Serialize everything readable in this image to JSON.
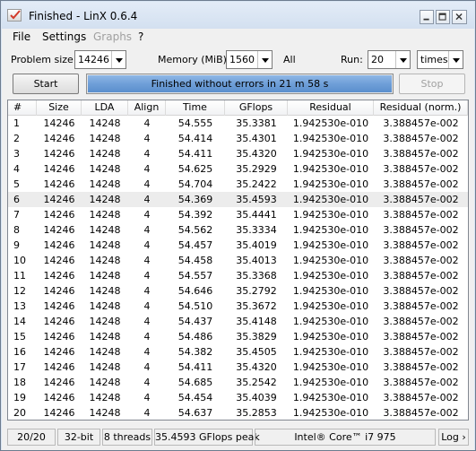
{
  "window": {
    "title": "Finished - LinX 0.6.4"
  },
  "menu": {
    "file": "File",
    "settings": "Settings",
    "graphs": "Graphs",
    "help": "?"
  },
  "controls": {
    "problem_size_label": "Problem size:",
    "problem_size_value": "14246",
    "memory_label": "Memory (MiB):",
    "memory_value": "1560",
    "all_label": "All",
    "run_label": "Run:",
    "run_value": "20",
    "times_value": "times",
    "start_label": "Start",
    "stop_label": "Stop"
  },
  "progress": {
    "text": "Finished without errors in 21 m 58 s",
    "fraction": 1.0,
    "color": "#6f9fd8"
  },
  "table": {
    "headers": [
      "#",
      "Size",
      "LDA",
      "Align",
      "Time",
      "GFlops",
      "Residual",
      "Residual (norm.)"
    ],
    "rows": [
      [
        "1",
        "14246",
        "14248",
        "4",
        "54.555",
        "35.3381",
        "1.942530e-010",
        "3.388457e-002"
      ],
      [
        "2",
        "14246",
        "14248",
        "4",
        "54.414",
        "35.4301",
        "1.942530e-010",
        "3.388457e-002"
      ],
      [
        "3",
        "14246",
        "14248",
        "4",
        "54.411",
        "35.4320",
        "1.942530e-010",
        "3.388457e-002"
      ],
      [
        "4",
        "14246",
        "14248",
        "4",
        "54.625",
        "35.2929",
        "1.942530e-010",
        "3.388457e-002"
      ],
      [
        "5",
        "14246",
        "14248",
        "4",
        "54.704",
        "35.2422",
        "1.942530e-010",
        "3.388457e-002"
      ],
      [
        "6",
        "14246",
        "14248",
        "4",
        "54.369",
        "35.4593",
        "1.942530e-010",
        "3.388457e-002"
      ],
      [
        "7",
        "14246",
        "14248",
        "4",
        "54.392",
        "35.4441",
        "1.942530e-010",
        "3.388457e-002"
      ],
      [
        "8",
        "14246",
        "14248",
        "4",
        "54.562",
        "35.3334",
        "1.942530e-010",
        "3.388457e-002"
      ],
      [
        "9",
        "14246",
        "14248",
        "4",
        "54.457",
        "35.4019",
        "1.942530e-010",
        "3.388457e-002"
      ],
      [
        "10",
        "14246",
        "14248",
        "4",
        "54.458",
        "35.4013",
        "1.942530e-010",
        "3.388457e-002"
      ],
      [
        "11",
        "14246",
        "14248",
        "4",
        "54.557",
        "35.3368",
        "1.942530e-010",
        "3.388457e-002"
      ],
      [
        "12",
        "14246",
        "14248",
        "4",
        "54.646",
        "35.2792",
        "1.942530e-010",
        "3.388457e-002"
      ],
      [
        "13",
        "14246",
        "14248",
        "4",
        "54.510",
        "35.3672",
        "1.942530e-010",
        "3.388457e-002"
      ],
      [
        "14",
        "14246",
        "14248",
        "4",
        "54.437",
        "35.4148",
        "1.942530e-010",
        "3.388457e-002"
      ],
      [
        "15",
        "14246",
        "14248",
        "4",
        "54.486",
        "35.3829",
        "1.942530e-010",
        "3.388457e-002"
      ],
      [
        "16",
        "14246",
        "14248",
        "4",
        "54.382",
        "35.4505",
        "1.942530e-010",
        "3.388457e-002"
      ],
      [
        "17",
        "14246",
        "14248",
        "4",
        "54.411",
        "35.4320",
        "1.942530e-010",
        "3.388457e-002"
      ],
      [
        "18",
        "14246",
        "14248",
        "4",
        "54.685",
        "35.2542",
        "1.942530e-010",
        "3.388457e-002"
      ],
      [
        "19",
        "14246",
        "14248",
        "4",
        "54.454",
        "35.4039",
        "1.942530e-010",
        "3.388457e-002"
      ],
      [
        "20",
        "14246",
        "14248",
        "4",
        "54.637",
        "35.2853",
        "1.942530e-010",
        "3.388457e-002"
      ]
    ],
    "highlighted_row": 6
  },
  "status": {
    "runs": "20/20",
    "bits": "32-bit",
    "threads": "8 threads",
    "peak": "35.4593 GFlops peak",
    "cpu": "Intel® Core™ i7 975",
    "log": "Log ›"
  }
}
